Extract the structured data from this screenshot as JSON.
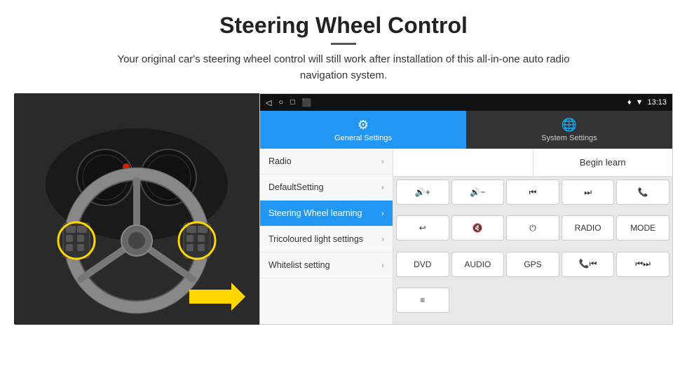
{
  "page": {
    "title": "Steering Wheel Control",
    "subtitle": "Your original car's steering wheel control will still work after installation of this all-in-one auto radio navigation system.",
    "title_divider": true
  },
  "status_bar": {
    "icons_left": [
      "◁",
      "○",
      "□",
      "⬛"
    ],
    "time": "13:13",
    "icons_right": [
      "♦",
      "▼"
    ]
  },
  "tabs": [
    {
      "label": "General Settings",
      "icon": "⚙",
      "active": true
    },
    {
      "label": "System Settings",
      "icon": "🌐",
      "active": false
    }
  ],
  "menu": [
    {
      "label": "Radio",
      "active": false
    },
    {
      "label": "DefaultSetting",
      "active": false
    },
    {
      "label": "Steering Wheel learning",
      "active": true
    },
    {
      "label": "Tricoloured light settings",
      "active": false
    },
    {
      "label": "Whitelist setting",
      "active": false
    }
  ],
  "begin_learn_label": "Begin learn",
  "control_buttons": [
    {
      "label": "🔊+",
      "type": "icon"
    },
    {
      "label": "🔊−",
      "type": "icon"
    },
    {
      "label": "⏮",
      "type": "icon"
    },
    {
      "label": "⏭",
      "type": "icon"
    },
    {
      "label": "📞",
      "type": "icon"
    },
    {
      "label": "↩",
      "type": "icon"
    },
    {
      "label": "🔊✕",
      "type": "icon"
    },
    {
      "label": "⏻",
      "type": "icon"
    },
    {
      "label": "RADIO",
      "type": "text"
    },
    {
      "label": "MODE",
      "type": "text"
    },
    {
      "label": "DVD",
      "type": "text"
    },
    {
      "label": "AUDIO",
      "type": "text"
    },
    {
      "label": "GPS",
      "type": "text"
    },
    {
      "label": "📞⏮",
      "type": "icon"
    },
    {
      "label": "⏮⏭",
      "type": "icon"
    },
    {
      "label": "≡",
      "type": "icon"
    }
  ]
}
